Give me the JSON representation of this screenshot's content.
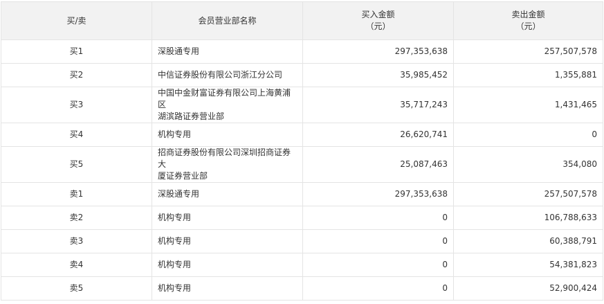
{
  "table": {
    "headers": {
      "side": "买/卖",
      "member": "会员营业部名称",
      "buy": "买入金额",
      "buy_unit": "（元）",
      "sell": "卖出金额",
      "sell_unit": "（元）"
    },
    "rows": [
      {
        "side": "买1",
        "name_lines": [
          "深股通专用"
        ],
        "buy": "297,353,638",
        "sell": "257,507,578"
      },
      {
        "side": "买2",
        "name_lines": [
          "中信证券股份有限公司浙江分公司"
        ],
        "buy": "35,985,452",
        "sell": "1,355,881"
      },
      {
        "side": "买3",
        "name_lines": [
          "中国中金财富证券有限公司上海黄浦区",
          "湖滨路证券营业部"
        ],
        "buy": "35,717,243",
        "sell": "1,431,465"
      },
      {
        "side": "买4",
        "name_lines": [
          "机构专用"
        ],
        "buy": "26,620,741",
        "sell": "0"
      },
      {
        "side": "买5",
        "name_lines": [
          "招商证券股份有限公司深圳招商证券大",
          "厦证券营业部"
        ],
        "buy": "25,087,463",
        "sell": "354,080"
      },
      {
        "side": "卖1",
        "name_lines": [
          "深股通专用"
        ],
        "buy": "297,353,638",
        "sell": "257,507,578"
      },
      {
        "side": "卖2",
        "name_lines": [
          "机构专用"
        ],
        "buy": "0",
        "sell": "106,788,633"
      },
      {
        "side": "卖3",
        "name_lines": [
          "机构专用"
        ],
        "buy": "0",
        "sell": "60,388,791"
      },
      {
        "side": "卖4",
        "name_lines": [
          "机构专用"
        ],
        "buy": "0",
        "sell": "54,381,823"
      },
      {
        "side": "卖5",
        "name_lines": [
          "机构专用"
        ],
        "buy": "0",
        "sell": "52,900,424"
      }
    ]
  }
}
